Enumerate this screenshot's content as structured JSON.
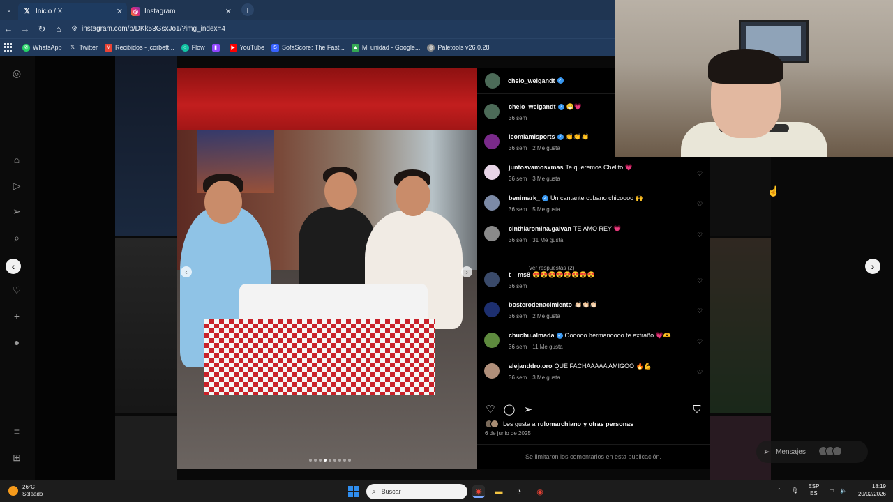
{
  "browser": {
    "tabs": [
      {
        "label": "Inicio / X",
        "icon": "x-logo-icon",
        "active": true
      },
      {
        "label": "Instagram",
        "icon": "instagram-icon",
        "active": false
      }
    ],
    "new_tab": "+",
    "url": "instagram.com/p/DKk53GsxJo1/?img_index=4",
    "bookmarks": [
      {
        "label": "WhatsApp",
        "icon": "whatsapp-icon",
        "color": "#25d366"
      },
      {
        "label": "Twitter",
        "icon": "x-logo-icon",
        "color": "#000000"
      },
      {
        "label": "Recibidos - jcorbett...",
        "icon": "gmail-icon",
        "color": "#ea4335"
      },
      {
        "label": "Flow",
        "icon": "flow-icon",
        "color": "#12c3a3"
      },
      {
        "label": "",
        "icon": "twitch-icon",
        "color": "#9146ff"
      },
      {
        "label": "YouTube",
        "icon": "youtube-icon",
        "color": "#ff0000"
      },
      {
        "label": "SofaScore: The Fast...",
        "icon": "sofascore-icon",
        "color": "#3762ff"
      },
      {
        "label": "Mi unidad - Google...",
        "icon": "google-drive-icon",
        "color": "#34a853"
      },
      {
        "label": "Paletools v26.0.28",
        "icon": "paletools-icon",
        "color": "#888888"
      }
    ]
  },
  "post": {
    "author": "chelo_weigandt",
    "comments": [
      {
        "user": "chelo_weigandt",
        "verified": true,
        "text": "😁💗",
        "time": "36 sem",
        "likes": "",
        "avatar_color": "#4c6b58"
      },
      {
        "user": "leomiamisports",
        "verified": true,
        "text": "👏👏👏",
        "time": "36 sem",
        "likes": "2 Me gusta",
        "avatar_color": "#7a2a8a"
      },
      {
        "user": "juntosvamosxmas",
        "verified": false,
        "text": "Te queremos Chelito 💗",
        "time": "36 sem",
        "likes": "3 Me gusta",
        "avatar_color": "#e7d4e6"
      },
      {
        "user": "benimark_",
        "verified": true,
        "text": "Un cantante cubano chicoooo 🙌",
        "time": "36 sem",
        "likes": "5 Me gusta",
        "avatar_color": "#7c8aa6"
      },
      {
        "user": "cinthiaromina.galvan",
        "verified": false,
        "text": "TE AMO REY 💗",
        "time": "36 sem",
        "likes": "31 Me gusta",
        "avatar_color": "#8a8a8a"
      },
      {
        "user": "t__ms8",
        "verified": false,
        "text": "😍😍😍😍😍😍😍😍",
        "time": "36 sem",
        "likes": "",
        "avatar_color": "#3a4a6a"
      },
      {
        "user": "bosterodenacimiento",
        "verified": false,
        "text": "👏🏻👏🏻👏🏻",
        "time": "36 sem",
        "likes": "2 Me gusta",
        "avatar_color": "#1d2f6f"
      },
      {
        "user": "chuchu.almada",
        "verified": true,
        "text": "Oooooo hermanoooo te extraño 💗🫶",
        "time": "36 sem",
        "likes": "11 Me gusta",
        "avatar_color": "#5e8a3e"
      },
      {
        "user": "alejanddro.oro",
        "verified": false,
        "text": "QUE FACHAAAAA AMIGOO 🔥💪",
        "time": "36 sem",
        "likes": "3 Me gusta",
        "avatar_color": "#b08f7a"
      }
    ],
    "view_replies": "Ver respuestas (2)",
    "liked_by_prefix": "Les gusta a",
    "liked_by_user": "rulomarchiano",
    "liked_by_suffix": "y otras personas",
    "date": "6 de junio de 2025",
    "comments_limited": "Se limitaron los comentarios en esta publicación.",
    "carousel_total": 9,
    "carousel_current": 4
  },
  "messages": {
    "label": "Mensajes"
  },
  "taskbar": {
    "weather_temp": "26°C",
    "weather_desc": "Soleado",
    "search_placeholder": "Buscar",
    "lang_top": "ESP",
    "lang_bottom": "ES",
    "time": "18:19",
    "date": "20/02/2026"
  }
}
